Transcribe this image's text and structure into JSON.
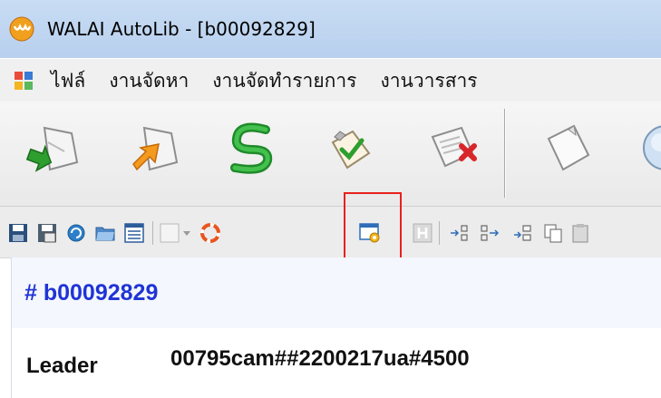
{
  "window": {
    "title": "WALAI AutoLib - [b00092829]",
    "app_icon": "walai-logo-icon"
  },
  "menu": {
    "system_icon": "system-menu-icon",
    "items": [
      {
        "label": "ไฟล์"
      },
      {
        "label": "งานจัดหา"
      },
      {
        "label": "งานจัดทำรายการ"
      },
      {
        "label": "งานวารสาร"
      }
    ]
  },
  "big_toolbar": {
    "buttons": [
      {
        "icon": "import-arrow-icon"
      },
      {
        "icon": "export-arrow-icon"
      },
      {
        "icon": "sync-dollar-icon"
      },
      {
        "icon": "approve-check-icon"
      },
      {
        "icon": "delete-record-icon"
      },
      {
        "icon": "new-document-icon"
      },
      {
        "icon": "search-globe-icon"
      }
    ]
  },
  "small_toolbar": {
    "buttons": [
      {
        "icon": "save-icon"
      },
      {
        "icon": "save-as-icon"
      },
      {
        "icon": "refresh-icon"
      },
      {
        "icon": "open-folder-icon"
      },
      {
        "icon": "list-view-icon"
      },
      {
        "icon": "template-dropdown-icon"
      },
      {
        "icon": "help-lifebuoy-icon"
      },
      {
        "icon": "window-settings-icon"
      },
      {
        "icon": "h-icon"
      },
      {
        "icon": "insert-field-icon"
      },
      {
        "icon": "append-field-icon"
      },
      {
        "icon": "insert-subfield-icon"
      },
      {
        "icon": "copy-icon"
      },
      {
        "icon": "paste-icon"
      }
    ],
    "highlighted": "window-settings-icon",
    "highlight_color": "#e8201c"
  },
  "record": {
    "id_label": "# b00092829",
    "id_color": "#1f34d6"
  },
  "fields": {
    "leader_label": "Leader",
    "leader_value": "00795cam##2200217ua#4500"
  }
}
